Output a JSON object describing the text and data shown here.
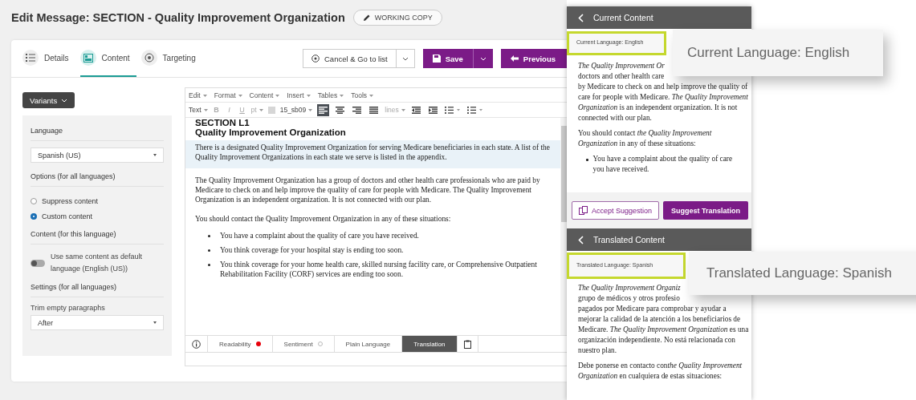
{
  "header": {
    "title": "Edit Message: SECTION - Quality Improvement Organization",
    "badge": "WORKING COPY"
  },
  "tabs": [
    {
      "label": "Details",
      "selected": false
    },
    {
      "label": "Content",
      "selected": true
    },
    {
      "label": "Targeting",
      "selected": false
    }
  ],
  "actions": {
    "cancel": "Cancel & Go to list",
    "save": "Save",
    "previous": "Previous"
  },
  "variants_button": "Variants",
  "settings": {
    "language_label": "Language",
    "language_value": "Spanish (US)",
    "options_label": "Options (for all languages)",
    "options": [
      {
        "label": "Suppress content",
        "selected": false
      },
      {
        "label": "Custom content",
        "selected": true
      }
    ],
    "content_label": "Content (for this language)",
    "toggle": {
      "label": "Use same content as default language (English (US))",
      "on": false
    },
    "settings_label": "Settings (for all languages)",
    "trim_label": "Trim empty paragraphs",
    "trim_value": "After"
  },
  "editor": {
    "menu": [
      "Edit",
      "Format",
      "Content",
      "Insert",
      "Tables",
      "Tools"
    ],
    "toolbar": [
      {
        "kind": "dropdown",
        "label": "Text",
        "disabled": false
      },
      {
        "kind": "bold",
        "label": "B",
        "disabled": true
      },
      {
        "kind": "italic",
        "label": "I",
        "disabled": true
      },
      {
        "kind": "underline",
        "label": "U",
        "disabled": true
      },
      {
        "kind": "dropdown",
        "label": "pt",
        "disabled": true
      },
      {
        "kind": "swatch",
        "disabled": true
      },
      {
        "kind": "dropdown",
        "label": "15_sb09",
        "disabled": false
      },
      {
        "kind": "align-left",
        "selected": true,
        "disabled": false
      },
      {
        "kind": "align-center",
        "selected": false,
        "disabled": false
      },
      {
        "kind": "align-right",
        "selected": false,
        "disabled": false
      },
      {
        "kind": "justify",
        "selected": false,
        "disabled": false
      },
      {
        "kind": "dropdown",
        "label": "lines",
        "disabled": true
      },
      {
        "kind": "outdent",
        "disabled": false
      },
      {
        "kind": "indent",
        "disabled": false
      },
      {
        "kind": "bullets",
        "disabled": false
      },
      {
        "kind": "numbering",
        "disabled": false
      }
    ],
    "heading": [
      "SECTION L1",
      "Quality Improvement Organization"
    ],
    "paragraphs": [
      {
        "text": "There is a designated Quality Improvement Organization for serving Medicare beneficiaries in each state. A list of the Quality Improvement Organizations in each state we serve is listed in the appendix.",
        "highlighted": true
      },
      {
        "text": "The Quality Improvement Organization has a group of doctors and other health care professionals who are paid by Medicare to check on and help improve the quality of care for people with Medicare. The Quality Improvement Organization is an independent organization. It is not connected with our plan.",
        "highlighted": false
      },
      {
        "text": "You should contact the Quality Improvement Organization in any of these situations:",
        "highlighted": false
      }
    ],
    "bullets": [
      "You have a complaint about the quality of care you have received.",
      "You think coverage for your hospital stay is ending too soon.",
      "You think coverage for your home health care, skilled nursing facility care, or Comprehensive Outpatient Rehabilitation Facility (CORF) services are ending too soon."
    ],
    "bottom_tabs": [
      {
        "kind": "info",
        "selected": false
      },
      {
        "kind": "text",
        "label": "Readability",
        "alert": true,
        "selected": false
      },
      {
        "kind": "text",
        "label": "Sentiment",
        "alert": false,
        "selected": false
      },
      {
        "kind": "text",
        "label": "Plain Language",
        "selected": false
      },
      {
        "kind": "text",
        "label": "Translation",
        "selected": true
      },
      {
        "kind": "clipboard",
        "selected": false
      }
    ]
  },
  "current_panel": {
    "title": "Current Content",
    "language_label": "Current Language: English",
    "callout": "Current Language: English",
    "lines": [
      {
        "text": "The Quality Improvement Or",
        "italic": true
      },
      {
        "text": "doctors and other health care",
        "italic": false
      },
      {
        "text": "by Medicare to check on and help improve the quality of",
        "italic": false
      },
      {
        "text": "care for people with Medicare. *The Quality Improvement*",
        "italic": false
      },
      {
        "text": "*Organization* is an independent organization. It is not",
        "italic": false
      },
      {
        "text": "connected with our plan.",
        "italic": false
      }
    ],
    "paragraph": [
      {
        "text": "You should contact ",
        "italic": false
      },
      {
        "text": "the Quality Improvement Organization",
        "italic": true
      },
      {
        "text": " in any of these situations:",
        "italic": false
      }
    ],
    "bullets": [
      "You have a complaint about the quality of care you have received."
    ],
    "buttons": {
      "accept": "Accept Suggestion",
      "suggest": "Suggest Translation"
    }
  },
  "translated_panel": {
    "title": "Translated Content",
    "language_label": "Translated Language: Spanish",
    "callout": "Translated Language: Spanish",
    "lines": [
      {
        "text": "The Quality Improvement Organiz",
        "italic": true
      },
      {
        "text": "grupo de médicos y otros profesio",
        "italic": false
      },
      {
        "text": "pagados por Medicare para comprobar y ayudar a",
        "italic": false
      },
      {
        "text": "mejorar la calidad de la atención a los beneficiarios de",
        "italic": false
      },
      {
        "text": "Medicare. *The Quality Improvement Organization* es una",
        "italic": false
      },
      {
        "text": "organización independiente. No está relacionada con",
        "italic": false
      },
      {
        "text": "nuestro plan.",
        "italic": false
      }
    ],
    "paragraph": [
      {
        "text": "Debe ponerse en contacto con",
        "italic": false
      },
      {
        "text": "the Quality Improvement Organization",
        "italic": true
      },
      {
        "text": " en cualquiera de estas situaciones:",
        "italic": false
      }
    ]
  }
}
